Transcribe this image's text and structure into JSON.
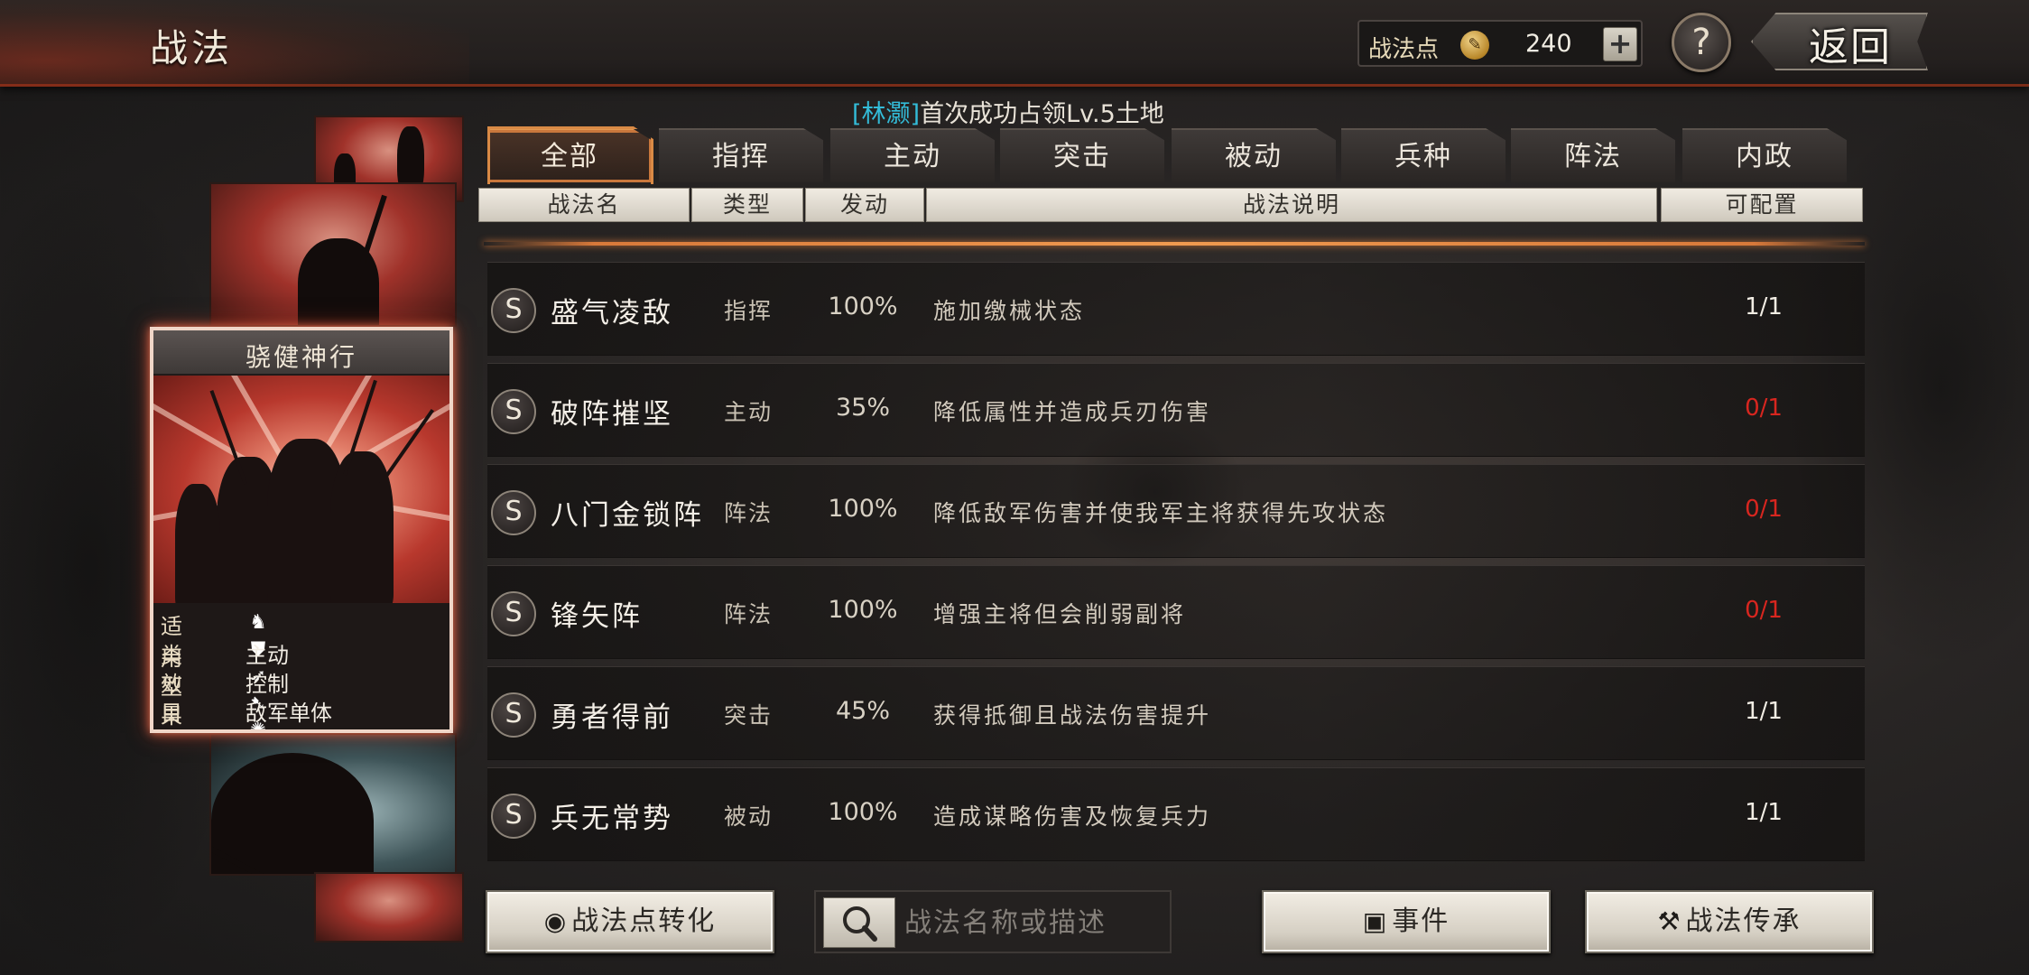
{
  "header": {
    "title": "战法",
    "points_label": "战法点",
    "points_value": "240",
    "plus_label": "+",
    "help_label": "?",
    "back_label": "返回"
  },
  "notice": {
    "player": "[林灏]",
    "text": "首次成功占领Lv.5土地"
  },
  "feature_card": {
    "title": "骁健神行",
    "rows": [
      {
        "key": "适用",
        "value": ""
      },
      {
        "key": "类型",
        "value": "主动"
      },
      {
        "key": "效果",
        "value": "控制"
      },
      {
        "key": "目标",
        "value": "敌军单体"
      }
    ],
    "unit_icons": [
      "cavalry-icon",
      "shield-icon",
      "bow-icon",
      "spear-icon",
      "chariot-icon"
    ]
  },
  "tabs": [
    "全部",
    "指挥",
    "主动",
    "突击",
    "被动",
    "兵种",
    "阵法",
    "内政"
  ],
  "active_tab": "全部",
  "columns": {
    "name": "战法名",
    "type": "类型",
    "rate": "发动",
    "desc": "战法说明",
    "config": "可配置"
  },
  "skills": [
    {
      "grade": "S",
      "name": "盛气凌敌",
      "type": "指挥",
      "rate": "100%",
      "desc": "施加缴械状态",
      "config": "1/1",
      "config_red": false
    },
    {
      "grade": "S",
      "name": "破阵摧坚",
      "type": "主动",
      "rate": "35%",
      "desc": "降低属性并造成兵刃伤害",
      "config": "0/1",
      "config_red": true
    },
    {
      "grade": "S",
      "name": "八门金锁阵",
      "type": "阵法",
      "rate": "100%",
      "desc": "降低敌军伤害并使我军主将获得先攻状态",
      "config": "0/1",
      "config_red": true
    },
    {
      "grade": "S",
      "name": "锋矢阵",
      "type": "阵法",
      "rate": "100%",
      "desc": "增强主将但会削弱副将",
      "config": "0/1",
      "config_red": true
    },
    {
      "grade": "S",
      "name": "勇者得前",
      "type": "突击",
      "rate": "45%",
      "desc": "获得抵御且战法伤害提升",
      "config": "1/1",
      "config_red": false
    },
    {
      "grade": "S",
      "name": "兵无常势",
      "type": "被动",
      "rate": "100%",
      "desc": "造成谋略伤害及恢复兵力",
      "config": "1/1",
      "config_red": false
    }
  ],
  "bottom": {
    "convert_label": "战法点转化",
    "search_placeholder": "战法名称或描述",
    "event_label": "事件",
    "inherit_label": "战法传承"
  },
  "colors": {
    "accent_orange": "#d8793a",
    "config_red": "#d8261f",
    "player_name": "#33bcd8"
  }
}
